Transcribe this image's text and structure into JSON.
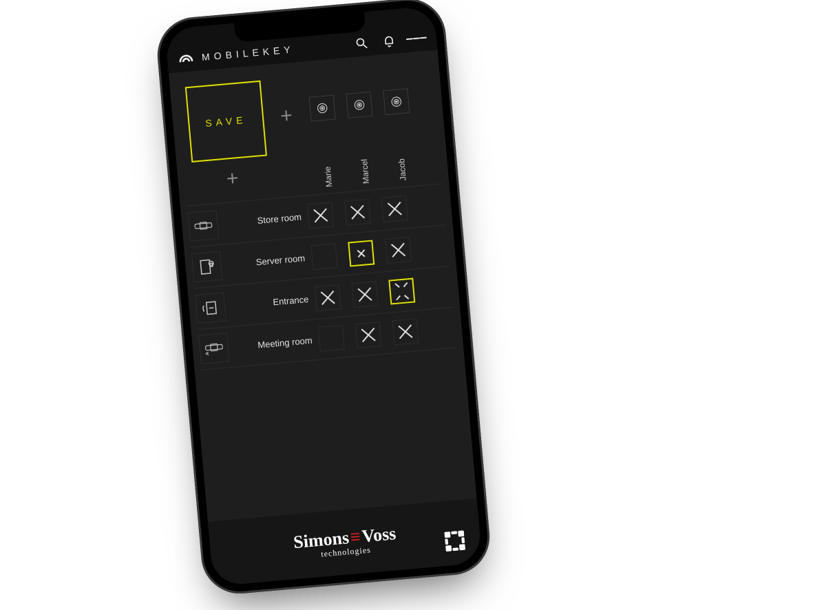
{
  "header": {
    "app_title": "MOBILEKEY"
  },
  "controls": {
    "save_label": "SAVE"
  },
  "users": [
    {
      "name": "Marie"
    },
    {
      "name": "Marcel"
    },
    {
      "name": "Jacob"
    }
  ],
  "locks": [
    {
      "label": "Store room",
      "icon": "cylinder"
    },
    {
      "label": "Server room",
      "icon": "door-lock"
    },
    {
      "label": "Entrance",
      "icon": "reader"
    },
    {
      "label": "Meeting room",
      "icon": "cylinder-wifi"
    }
  ],
  "matrix": [
    [
      "x",
      "x",
      "x"
    ],
    [
      "",
      "x-sel",
      "x"
    ],
    [
      "x",
      "x",
      "dash-sel"
    ],
    [
      "",
      "x",
      "x"
    ]
  ],
  "footer": {
    "brand_a": "Simons",
    "brand_b": "Voss",
    "tagline": "technologies"
  },
  "colors": {
    "accent": "#e0e000",
    "bg": "#1e1e1e"
  }
}
